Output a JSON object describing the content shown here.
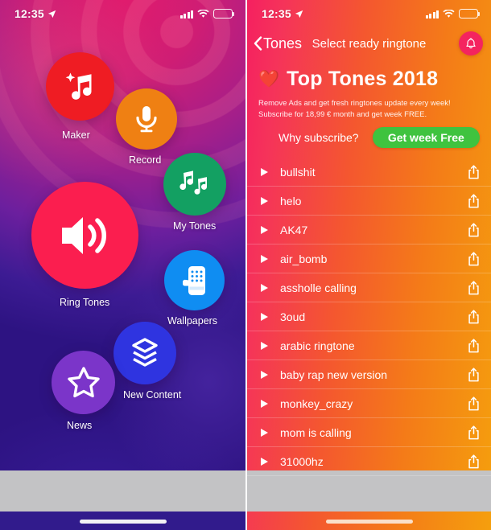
{
  "status_bar": {
    "time": "12:35",
    "location_icon": "location-arrow-icon",
    "signal_icon": "cellular-signal-icon",
    "wifi_icon": "wifi-icon",
    "battery_icon": "battery-icon"
  },
  "left_screen": {
    "name": "ringtone-app-home",
    "tiles": [
      {
        "id": "maker",
        "label": "Maker",
        "icon": "sparkle-music-note-icon",
        "color": "#ef1c23"
      },
      {
        "id": "record",
        "label": "Record",
        "icon": "microphone-icon",
        "color": "#ef8013"
      },
      {
        "id": "mytones",
        "label": "My Tones",
        "icon": "music-notes-icon",
        "color": "#13a062"
      },
      {
        "id": "ringtones",
        "label": "Ring Tones",
        "icon": "speaker-volume-icon",
        "color": "#fb1e4f"
      },
      {
        "id": "wallpapers",
        "label": "Wallpapers",
        "icon": "phone-wallpaper-icon",
        "color": "#0f8df2"
      },
      {
        "id": "newcontent",
        "label": "New Content",
        "icon": "layers-stack-icon",
        "color": "#2f34e0"
      },
      {
        "id": "news",
        "label": "News",
        "icon": "star-outline-icon",
        "color": "#7b35c9"
      }
    ]
  },
  "right_screen": {
    "navbar": {
      "back_label": "Tones",
      "back_icon": "chevron-left-icon",
      "title": "Select ready ringtone",
      "bell_icon": "bell-icon",
      "bell_color": "#f4245f"
    },
    "promo": {
      "heart_icon": "heart-emoji",
      "title": "Top Tones 2018",
      "subtitle": "Remove Ads and get fresh ringtones update every week! Subscribe for 18,99 € month and get week FREE.",
      "why_label": "Why subscribe?",
      "cta_label": "Get week Free",
      "cta_color": "#3fc33f"
    },
    "list": {
      "play_icon": "play-triangle-icon",
      "share_icon": "share-export-icon",
      "items": [
        {
          "name": "bullshit"
        },
        {
          "name": "helo"
        },
        {
          "name": "AK47"
        },
        {
          "name": "air_bomb"
        },
        {
          "name": "assholle calling"
        },
        {
          "name": "3oud"
        },
        {
          "name": "arabic ringtone"
        },
        {
          "name": "baby rap new version"
        },
        {
          "name": "monkey_crazy"
        },
        {
          "name": "mom is calling"
        },
        {
          "name": "31000hz"
        }
      ]
    }
  },
  "bottom": {
    "ad_banner_color": "#c3c3c5",
    "home_indicator": "home-indicator"
  }
}
